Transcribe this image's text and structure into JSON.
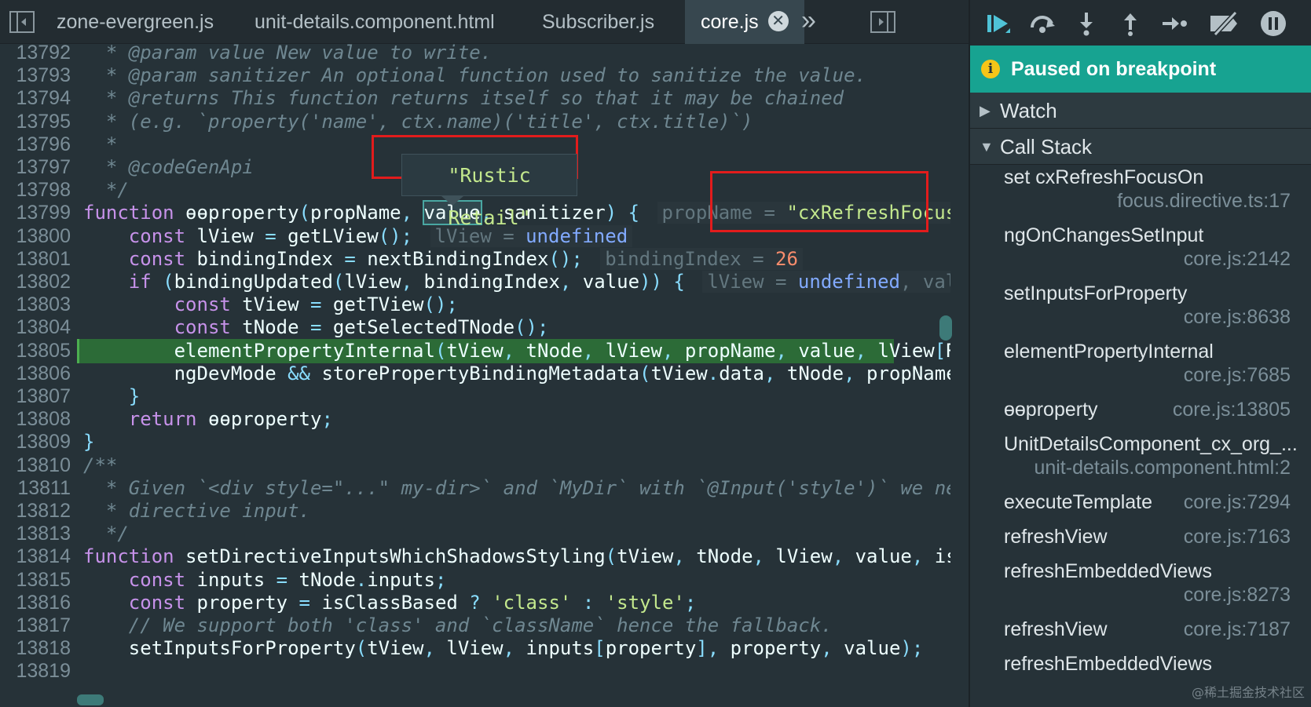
{
  "tabs": [
    {
      "label": "zone-evergreen.js",
      "active": false
    },
    {
      "label": "unit-details.component.html",
      "active": false
    },
    {
      "label": "Subscriber.js",
      "active": false
    },
    {
      "label": "core.js",
      "active": true
    }
  ],
  "tab_close_glyph": "✕",
  "tab_more_glyph": "»",
  "tooltip": {
    "value": "\"Rustic Retail\""
  },
  "code_lines": [
    {
      "num": "13792",
      "html": "<span class=\"c\">  * @param value New value to write.</span>"
    },
    {
      "num": "13793",
      "html": "<span class=\"c\">  * @param sanitizer An optional function used to sanitize the value.</span>"
    },
    {
      "num": "13794",
      "html": "<span class=\"c\">  * @returns This function returns itself so that it may be chained</span>"
    },
    {
      "num": "13795",
      "html": "<span class=\"c\">  * (e.g. `property('name', ctx.name)('title', ctx.title)`)</span>"
    },
    {
      "num": "13796",
      "html": "<span class=\"c\">  *</span>"
    },
    {
      "num": "13797",
      "html": "<span class=\"c\">  * @codeGenApi</span>"
    },
    {
      "num": "13798",
      "html": "<span class=\"c\">  */</span>"
    },
    {
      "num": "13799",
      "html": "<span class=\"k\">function</span> ɵɵproperty<span class=\"p\">(</span>propName<span class=\"p\">,</span> <span class=\"hl-word\">value</span><span class=\"p\">,</span> sanitizer<span class=\"p\">)</span> <span class=\"p\">{</span> <span class=\"inl\">propName = <span class=\"iv\">\"cxRefreshFocusOn\"</span></span>"
    },
    {
      "num": "13800",
      "html": "    <span class=\"k\">const</span> lView <span class=\"p\">=</span> getLView<span class=\"p\">();</span> <span class=\"inl\">lView = <span class=\"iu\">undefined</span></span>"
    },
    {
      "num": "13801",
      "html": "    <span class=\"k\">const</span> bindingIndex <span class=\"p\">=</span> nextBindingIndex<span class=\"p\">();</span> <span class=\"inl\">bindingIndex = <span class=\"in\">26</span></span>"
    },
    {
      "num": "13802",
      "html": "    <span class=\"k\">if</span> <span class=\"p\">(</span>bindingUpdated<span class=\"p\">(</span>lView<span class=\"p\">,</span> bindingIndex<span class=\"p\">,</span> value<span class=\"p\">))</span> <span class=\"p\">{</span> <span class=\"inl\">lView = <span class=\"iu\">undefined</span>, value = \"Rustic Retail\"</span>"
    },
    {
      "num": "13803",
      "html": "        <span class=\"k\">const</span> tView <span class=\"p\">=</span> getTView<span class=\"p\">();</span>"
    },
    {
      "num": "13804",
      "html": "        <span class=\"k\">const</span> tNode <span class=\"p\">=</span> getSelectedTNode<span class=\"p\">();</span>"
    },
    {
      "num": "13805",
      "exec": true,
      "html": "        elementPropertyInternal<span class=\"p\">(</span>tView<span class=\"p\">,</span> tNode<span class=\"p\">,</span> lView<span class=\"p\">,</span> propName<span class=\"p\">,</span> value<span class=\"p\">,</span> lView<span class=\"p\">[</span>RENDERER<span class=\"p\">],</span> sanitizer<span class=\"p\">,</span> <span class=\"k\">false</span><span class=\"p\">);</span>"
    },
    {
      "num": "13806",
      "html": "        ngDevMode <span class=\"p\">&amp;&amp;</span> storePropertyBindingMetadata<span class=\"p\">(</span>tView<span class=\"p\">.</span>data<span class=\"p\">,</span> tNode<span class=\"p\">,</span> propName<span class=\"p\">,</span> bindingIndex<span class=\"p\">);</span>"
    },
    {
      "num": "13807",
      "html": "    <span class=\"p\">}</span>"
    },
    {
      "num": "13808",
      "html": "    <span class=\"k\">return</span> ɵɵproperty<span class=\"p\">;</span>"
    },
    {
      "num": "13809",
      "html": "<span class=\"p\">}</span>"
    },
    {
      "num": "13810",
      "html": "<span class=\"c\">/**</span>"
    },
    {
      "num": "13811",
      "html": "<span class=\"c\">  * Given `&lt;div style=\"...\" my-dir&gt;` and `MyDir` with `@Input('style')` we need to write to</span>"
    },
    {
      "num": "13812",
      "html": "<span class=\"c\">  * directive input.</span>"
    },
    {
      "num": "13813",
      "html": "<span class=\"c\">  */</span>"
    },
    {
      "num": "13814",
      "html": "<span class=\"k\">function</span> setDirectiveInputsWhichShadowsStyling<span class=\"p\">(</span>tView<span class=\"p\">,</span> tNode<span class=\"p\">,</span> lView<span class=\"p\">,</span> value<span class=\"p\">,</span> isClassBased<span class=\"p\">)</span> <span class=\"p\">{</span>"
    },
    {
      "num": "13815",
      "html": "    <span class=\"k\">const</span> inputs <span class=\"p\">=</span> tNode<span class=\"p\">.</span>inputs<span class=\"p\">;</span>"
    },
    {
      "num": "13816",
      "html": "    <span class=\"k\">const</span> property <span class=\"p\">=</span> isClassBased <span class=\"p\">?</span> <span class=\"s\">'class'</span> <span class=\"p\">:</span> <span class=\"s\">'style'</span><span class=\"p\">;</span>"
    },
    {
      "num": "13817",
      "html": "<span class=\"c\">    // We support both 'class' and `className` hence the fallback.</span>"
    },
    {
      "num": "13818",
      "html": "    setInputsForProperty<span class=\"p\">(</span>tView<span class=\"p\">,</span> lView<span class=\"p\">,</span> inputs<span class=\"p\">[</span>property<span class=\"p\">],</span> property<span class=\"p\">,</span> value<span class=\"p\">);</span>"
    },
    {
      "num": "13819",
      "html": ""
    }
  ],
  "debugger": {
    "paused_label": "Paused on breakpoint",
    "info_glyph": "i",
    "watch_label": "Watch",
    "callstack_label": "Call Stack",
    "frames": [
      {
        "name": "set cxRefreshFocusOn",
        "location": "focus.directive.ts:17",
        "two_line": true
      },
      {
        "name": "ngOnChangesSetInput",
        "location": "core.js:2142",
        "two_line": true
      },
      {
        "name": "setInputsForProperty",
        "location": "core.js:8638",
        "two_line": true
      },
      {
        "name": "elementPropertyInternal",
        "location": "core.js:7685",
        "two_line": true
      },
      {
        "name": "ɵɵproperty",
        "location": "core.js:13805",
        "two_line": false
      },
      {
        "name": "UnitDetailsComponent_cx_org_...",
        "location": "unit-details.component.html:2",
        "two_line": true
      },
      {
        "name": "executeTemplate",
        "location": "core.js:7294",
        "two_line": false
      },
      {
        "name": "refreshView",
        "location": "core.js:7163",
        "two_line": false
      },
      {
        "name": "refreshEmbeddedViews",
        "location": "core.js:8273",
        "two_line": true
      },
      {
        "name": "refreshView",
        "location": "core.js:7187",
        "two_line": false
      },
      {
        "name": "refreshEmbeddedViews",
        "location": "",
        "two_line": false
      }
    ]
  },
  "watermark": "@稀土掘金技术社区",
  "colors": {
    "paused_bg": "#17a391",
    "exec_line": "#2c6b37",
    "annotation_box": "#e21c1c"
  }
}
